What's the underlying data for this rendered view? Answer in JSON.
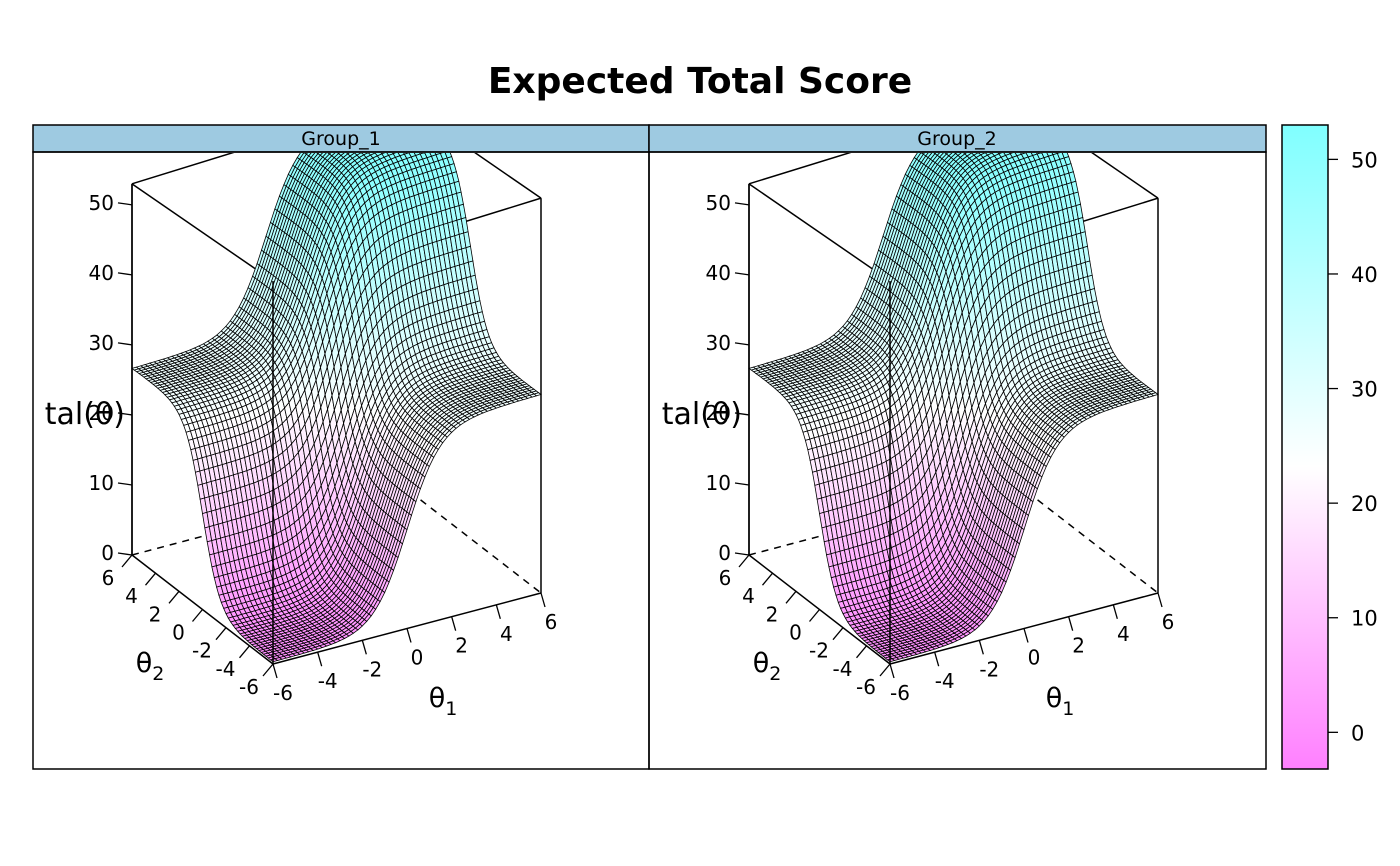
{
  "title": "Expected Total Score",
  "colors": {
    "strip": "#9ECAE1",
    "surface_low": "#FF80FF",
    "surface_mid": "#FFFFFF",
    "surface_high": "#80FFFF",
    "mesh": "#000000"
  },
  "colorkey": {
    "ticks": [
      "0",
      "10",
      "20",
      "30",
      "40",
      "50"
    ],
    "range": [
      -3.2,
      53
    ]
  },
  "chart_data": [
    {
      "type": "surface",
      "panel": "Group_1",
      "xlabel": "θ1",
      "ylabel": "θ2",
      "zlabel": "tal(θ)",
      "xlim": [
        -6,
        6
      ],
      "ylim": [
        -6,
        6
      ],
      "zlim": [
        0,
        53
      ],
      "x_ticks": [
        "-6",
        "-4",
        "-2",
        "0",
        "2",
        "4",
        "6"
      ],
      "y_ticks": [
        "-6",
        "-4",
        "-2",
        "0",
        "2",
        "4",
        "6"
      ],
      "z_ticks": [
        "0",
        "10",
        "20",
        "30",
        "40",
        "50"
      ],
      "grid_n": 61,
      "z_samples": {
        "theta_min_min": 0.3,
        "theta1_max_theta2_min": 26,
        "theta1_min_theta2_max": 26,
        "theta_max_max": 53
      }
    },
    {
      "type": "surface",
      "panel": "Group_2",
      "xlabel": "θ1",
      "ylabel": "θ2",
      "zlabel": "tal(θ)",
      "xlim": [
        -6,
        6
      ],
      "ylim": [
        -6,
        6
      ],
      "zlim": [
        0,
        53
      ],
      "x_ticks": [
        "-6",
        "-4",
        "-2",
        "0",
        "2",
        "4",
        "6"
      ],
      "y_ticks": [
        "-6",
        "-4",
        "-2",
        "0",
        "2",
        "4",
        "6"
      ],
      "z_ticks": [
        "0",
        "10",
        "20",
        "30",
        "40",
        "50"
      ],
      "grid_n": 61,
      "z_samples": {
        "theta_min_min": 0.3,
        "theta1_max_theta2_min": 26,
        "theta1_min_theta2_max": 26,
        "theta_max_max": 53
      }
    }
  ]
}
